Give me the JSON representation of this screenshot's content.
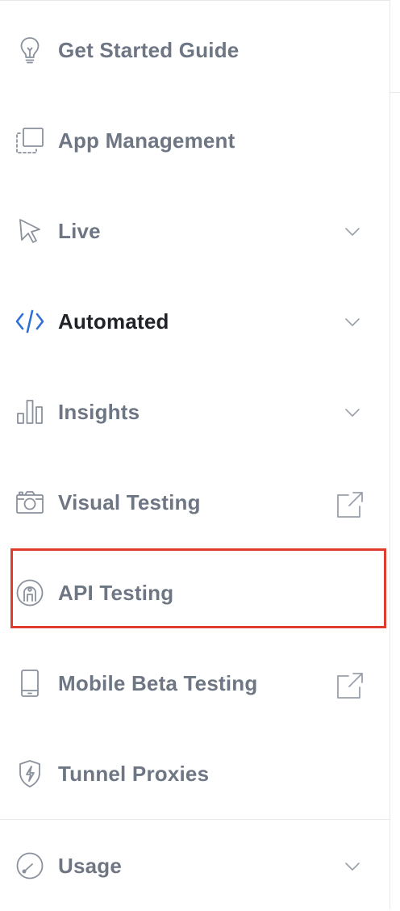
{
  "sidebar": {
    "items": [
      {
        "label": "Get Started Guide",
        "icon": "lightbulb-icon",
        "has_chevron": false,
        "has_external": false,
        "active": false
      },
      {
        "label": "App Management",
        "icon": "app-stack-icon",
        "has_chevron": false,
        "has_external": false,
        "active": false
      },
      {
        "label": "Live",
        "icon": "cursor-pointer-icon",
        "has_chevron": true,
        "has_external": false,
        "active": false
      },
      {
        "label": "Automated",
        "icon": "code-brackets-icon",
        "has_chevron": true,
        "has_external": false,
        "active": true
      },
      {
        "label": "Insights",
        "icon": "bar-chart-icon",
        "has_chevron": true,
        "has_external": false,
        "active": false
      },
      {
        "label": "Visual Testing",
        "icon": "camera-icon",
        "has_chevron": false,
        "has_external": true,
        "active": false
      },
      {
        "label": "API Testing",
        "icon": "api-bridge-icon",
        "has_chevron": false,
        "has_external": false,
        "active": false,
        "highlighted": true
      },
      {
        "label": "Mobile Beta Testing",
        "icon": "mobile-phone-icon",
        "has_chevron": false,
        "has_external": true,
        "active": false
      },
      {
        "label": "Tunnel Proxies",
        "icon": "shield-bolt-icon",
        "has_chevron": false,
        "has_external": false,
        "active": false
      },
      {
        "label": "Usage",
        "icon": "gauge-icon",
        "has_chevron": true,
        "has_external": false,
        "active": false
      }
    ]
  },
  "colors": {
    "label_default": "#6e7684",
    "label_active": "#1f2328",
    "icon_default": "#8a919c",
    "icon_active": "#2f6fd6",
    "highlight_border": "#e03c2d",
    "divider": "#e6e8ec"
  }
}
